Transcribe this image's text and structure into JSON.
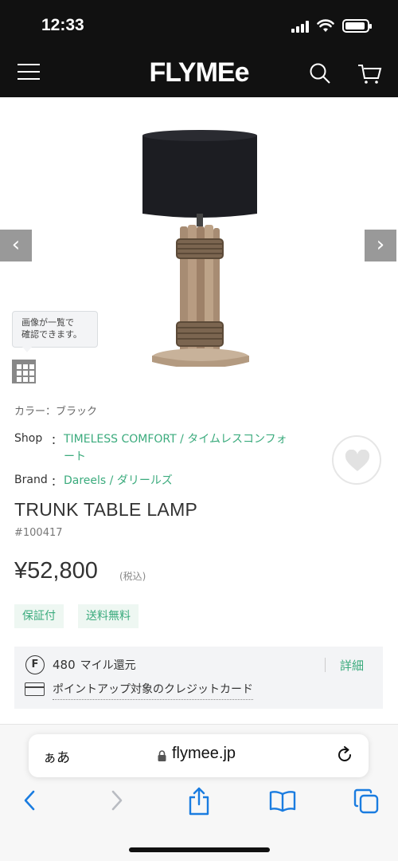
{
  "status_bar": {
    "time": "12:33",
    "icons": [
      "signal-icon",
      "wifi-icon",
      "battery-icon"
    ]
  },
  "header": {
    "logo": "FLYMEe",
    "icons": [
      "menu-icon",
      "search-icon",
      "cart-icon"
    ]
  },
  "gallery": {
    "tooltip_line1": "画像が一覧で",
    "tooltip_line2": "確認できます。",
    "prev_arrow": "‹",
    "next_arrow": "›"
  },
  "product": {
    "color": "カラー：ブラック",
    "shop_label": "Shop",
    "shop_colon": "：",
    "shop_name": "TIMELESS COMFORT / タイムレスコンフォート",
    "brand_label": "Brand",
    "brand_colon": "：",
    "brand_name": "Dareels / ダリールズ",
    "title": "TRUNK TABLE LAMP",
    "sku": "#100417",
    "price": "¥52,800",
    "tax_note": "(税込)",
    "tags": [
      "保証付",
      "送料無料"
    ]
  },
  "benefits": {
    "mile_icon": "F",
    "miles": "480",
    "mile_unit": "マイル還元",
    "details_link": "詳細",
    "card_link": "ポイントアップ対象のクレジットカード"
  },
  "browser": {
    "aa": "ぁあ",
    "url": "flymee.jp",
    "toolbar_icons": [
      "back-icon",
      "forward-icon",
      "share-icon",
      "bookmarks-icon",
      "tabs-icon"
    ]
  },
  "colors": {
    "accent_green": "#3bab7d",
    "header_black": "#111111",
    "safari_blue": "#1a7ce0"
  }
}
